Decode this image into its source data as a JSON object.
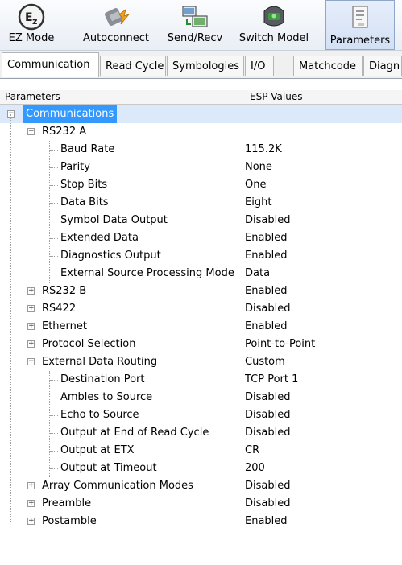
{
  "toolbar": {
    "buttons": [
      {
        "label": "EZ Mode",
        "icon": "ez-mode-icon"
      },
      {
        "label": "Autoconnect",
        "icon": "autoconnect-icon"
      },
      {
        "label": "Send/Recv",
        "icon": "send-recv-icon"
      },
      {
        "label": "Switch Model",
        "icon": "switch-model-icon"
      },
      {
        "label": "Parameters",
        "icon": "parameters-icon"
      }
    ]
  },
  "tabs": [
    "Communication",
    "Read Cycle",
    "Symbologies",
    "I/O",
    "Matchcode",
    "Diagn"
  ],
  "grid": {
    "headers": {
      "parameter": "Parameters",
      "value": "ESP Values"
    },
    "rows": [
      {
        "label": "Communications",
        "value": "",
        "level": 0,
        "expander": "minus"
      },
      {
        "label": "RS232 A",
        "value": "",
        "level": 1,
        "expander": "minus"
      },
      {
        "label": "Baud Rate",
        "value": "115.2K",
        "level": 2,
        "expander": ""
      },
      {
        "label": "Parity",
        "value": "None",
        "level": 2,
        "expander": ""
      },
      {
        "label": "Stop Bits",
        "value": "One",
        "level": 2,
        "expander": ""
      },
      {
        "label": "Data Bits",
        "value": "Eight",
        "level": 2,
        "expander": ""
      },
      {
        "label": "Symbol Data Output",
        "value": "Disabled",
        "level": 2,
        "expander": ""
      },
      {
        "label": "Extended Data",
        "value": "Enabled",
        "level": 2,
        "expander": ""
      },
      {
        "label": "Diagnostics Output",
        "value": "Enabled",
        "level": 2,
        "expander": ""
      },
      {
        "label": "External Source Processing Mode",
        "value": "Data",
        "level": 2,
        "expander": ""
      },
      {
        "label": "RS232 B",
        "value": "Enabled",
        "level": 1,
        "expander": "plus"
      },
      {
        "label": "RS422",
        "value": "Disabled",
        "level": 1,
        "expander": "plus"
      },
      {
        "label": "Ethernet",
        "value": "Enabled",
        "level": 1,
        "expander": "plus"
      },
      {
        "label": "Protocol Selection",
        "value": "Point-to-Point",
        "level": 1,
        "expander": "plus"
      },
      {
        "label": "External Data Routing",
        "value": "Custom",
        "level": 1,
        "expander": "minus"
      },
      {
        "label": "Destination Port",
        "value": "TCP Port 1",
        "level": 2,
        "expander": ""
      },
      {
        "label": "Ambles to Source",
        "value": "Disabled",
        "level": 2,
        "expander": ""
      },
      {
        "label": "Echo to Source",
        "value": "Disabled",
        "level": 2,
        "expander": ""
      },
      {
        "label": "Output at End of Read Cycle",
        "value": "Disabled",
        "level": 2,
        "expander": ""
      },
      {
        "label": "Output at ETX",
        "value": "CR",
        "level": 2,
        "expander": ""
      },
      {
        "label": "Output at Timeout",
        "value": "200",
        "level": 2,
        "expander": ""
      },
      {
        "label": "Array Communication Modes",
        "value": "Disabled",
        "level": 1,
        "expander": "plus"
      },
      {
        "label": "Preamble",
        "value": "Disabled",
        "level": 1,
        "expander": "plus"
      },
      {
        "label": "Postamble",
        "value": "Enabled",
        "level": 1,
        "expander": "plus"
      }
    ]
  },
  "colors": {
    "selection": "#3399ff",
    "selection_row": "#dbe9fb"
  }
}
